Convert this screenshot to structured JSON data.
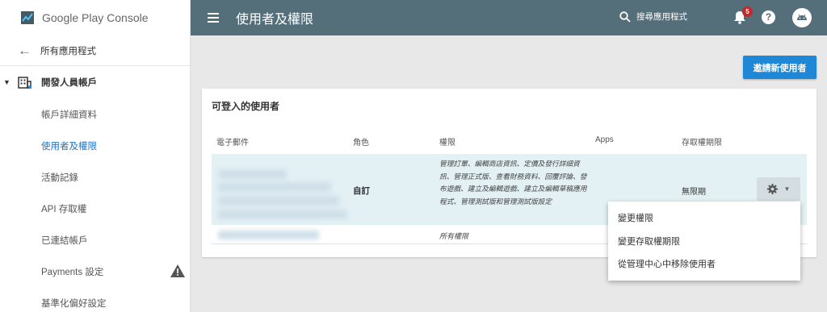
{
  "app": {
    "logo_text": "Google Play Console"
  },
  "sidebar": {
    "back_label": "所有應用程式",
    "dev_account_label": "開發人員帳戶",
    "items": [
      {
        "label": "帳戶詳細資料"
      },
      {
        "label": "使用者及權限"
      },
      {
        "label": "活動記錄"
      },
      {
        "label": "API 存取權"
      },
      {
        "label": "已連結帳戶"
      },
      {
        "label": "Payments 設定"
      },
      {
        "label": "基準化偏好設定"
      }
    ]
  },
  "header": {
    "title": "使用者及權限",
    "search_label": "搜尋應用程式",
    "notification_count": "5",
    "help_label": "?"
  },
  "invite_button": "邀請新使用者",
  "card": {
    "title": "可登入的使用者",
    "columns": [
      "電子郵件",
      "角色",
      "權限",
      "Apps",
      "存取權期限"
    ],
    "rows": [
      {
        "role": "自訂",
        "permissions": "管理訂單、編輯商店資訊、定價及發行詳細資訊、管理正式版、查看財務資料、回覆評論、發布遊戲、建立及編輯遊戲、建立及編輯草稿應用程式、管理測試版和管理測試版設定",
        "access": "無限期"
      },
      {
        "role": "",
        "permissions": "所有權限",
        "access": ""
      }
    ]
  },
  "context_menu": {
    "items": [
      "變更權限",
      "變更存取權期限",
      "從管理中心中移除使用者"
    ]
  },
  "colors": {
    "topbar": "#546e7a",
    "accent": "#1e88d7",
    "active_nav": "#1a73c8",
    "badge": "#c62828"
  }
}
